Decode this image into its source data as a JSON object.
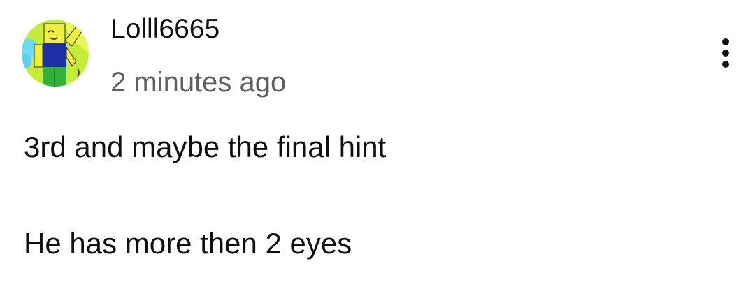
{
  "comment": {
    "author": "Lolll6665",
    "timestamp": "2 minutes ago",
    "avatar_icon": "roblox-noob-avatar-icon",
    "text_lines": [
      "3rd and maybe the final hint",
      "He has more then 2 eyes"
    ],
    "menu_icon": "more-vertical-icon"
  },
  "colors": {
    "author_text": "#0f0f0f",
    "secondary_text": "#606060",
    "background": "#ffffff"
  }
}
